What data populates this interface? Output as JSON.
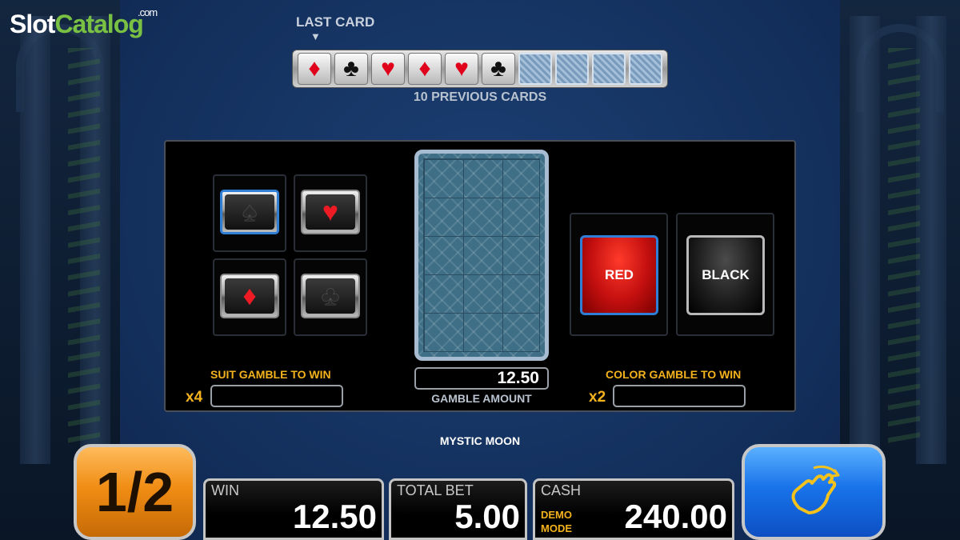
{
  "logo": {
    "brand_part1": "Slot",
    "brand_part2": "Catalog",
    "suffix": ".com"
  },
  "history": {
    "last_card_label": "LAST CARD",
    "previous_cards_label": "10 PREVIOUS CARDS",
    "cards": [
      {
        "suit": "diamond",
        "symbol": "♦",
        "color": "red"
      },
      {
        "suit": "club",
        "symbol": "♣",
        "color": "black"
      },
      {
        "suit": "heart",
        "symbol": "♥",
        "color": "red"
      },
      {
        "suit": "diamond",
        "symbol": "♦",
        "color": "red"
      },
      {
        "suit": "heart",
        "symbol": "♥",
        "color": "red"
      },
      {
        "suit": "club",
        "symbol": "♣",
        "color": "black"
      },
      {
        "suit": "back"
      },
      {
        "suit": "back"
      },
      {
        "suit": "back"
      },
      {
        "suit": "back"
      }
    ]
  },
  "suits": {
    "spade": "♠",
    "heart": "♥",
    "diamond": "♦",
    "club": "♣",
    "selected": "spade"
  },
  "suit_gamble": {
    "label": "SUIT GAMBLE TO WIN",
    "multiplier": "x4",
    "value": ""
  },
  "color_gamble": {
    "label": "COLOR GAMBLE TO WIN",
    "multiplier": "x2",
    "value": "",
    "red_label": "RED",
    "black_label": "BLACK"
  },
  "gamble": {
    "amount": "12.50",
    "amount_label": "GAMBLE AMOUNT"
  },
  "game_title": "MYSTIC MOON",
  "controls": {
    "half_label": "1/2",
    "take_icon": "hand-icon"
  },
  "meters": {
    "win_label": "WIN",
    "win_value": "12.50",
    "total_bet_label": "TOTAL BET",
    "total_bet_value": "5.00",
    "cash_label": "CASH",
    "cash_value": "240.00",
    "demo_line1": "DEMO",
    "demo_line2": "MODE"
  },
  "colors": {
    "accent_orange": "#f4b21c",
    "red_button": "#c30f0f",
    "blue_button": "#1873ea",
    "brand_green": "#7ac143"
  }
}
